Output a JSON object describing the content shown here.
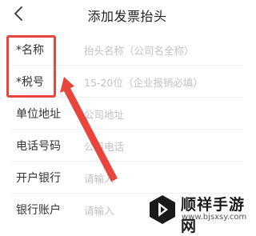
{
  "header": {
    "title": "添加发票抬头"
  },
  "form": {
    "fields": [
      {
        "label": "*名称",
        "placeholder": "抬头名称（公司名全称）"
      },
      {
        "label": "*税号",
        "placeholder": "15-20位（企业报销必填）"
      },
      {
        "label": "单位地址",
        "placeholder": "公司地址"
      },
      {
        "label": "电话号码",
        "placeholder": "公司电话"
      },
      {
        "label": "开户银行",
        "placeholder": "请输入"
      },
      {
        "label": "银行账户",
        "placeholder": "请输入"
      }
    ]
  },
  "annotation": {
    "color": "#e8453c"
  },
  "watermark": {
    "title": "顺祥手游网",
    "url": "www.bjsxsy.com"
  }
}
